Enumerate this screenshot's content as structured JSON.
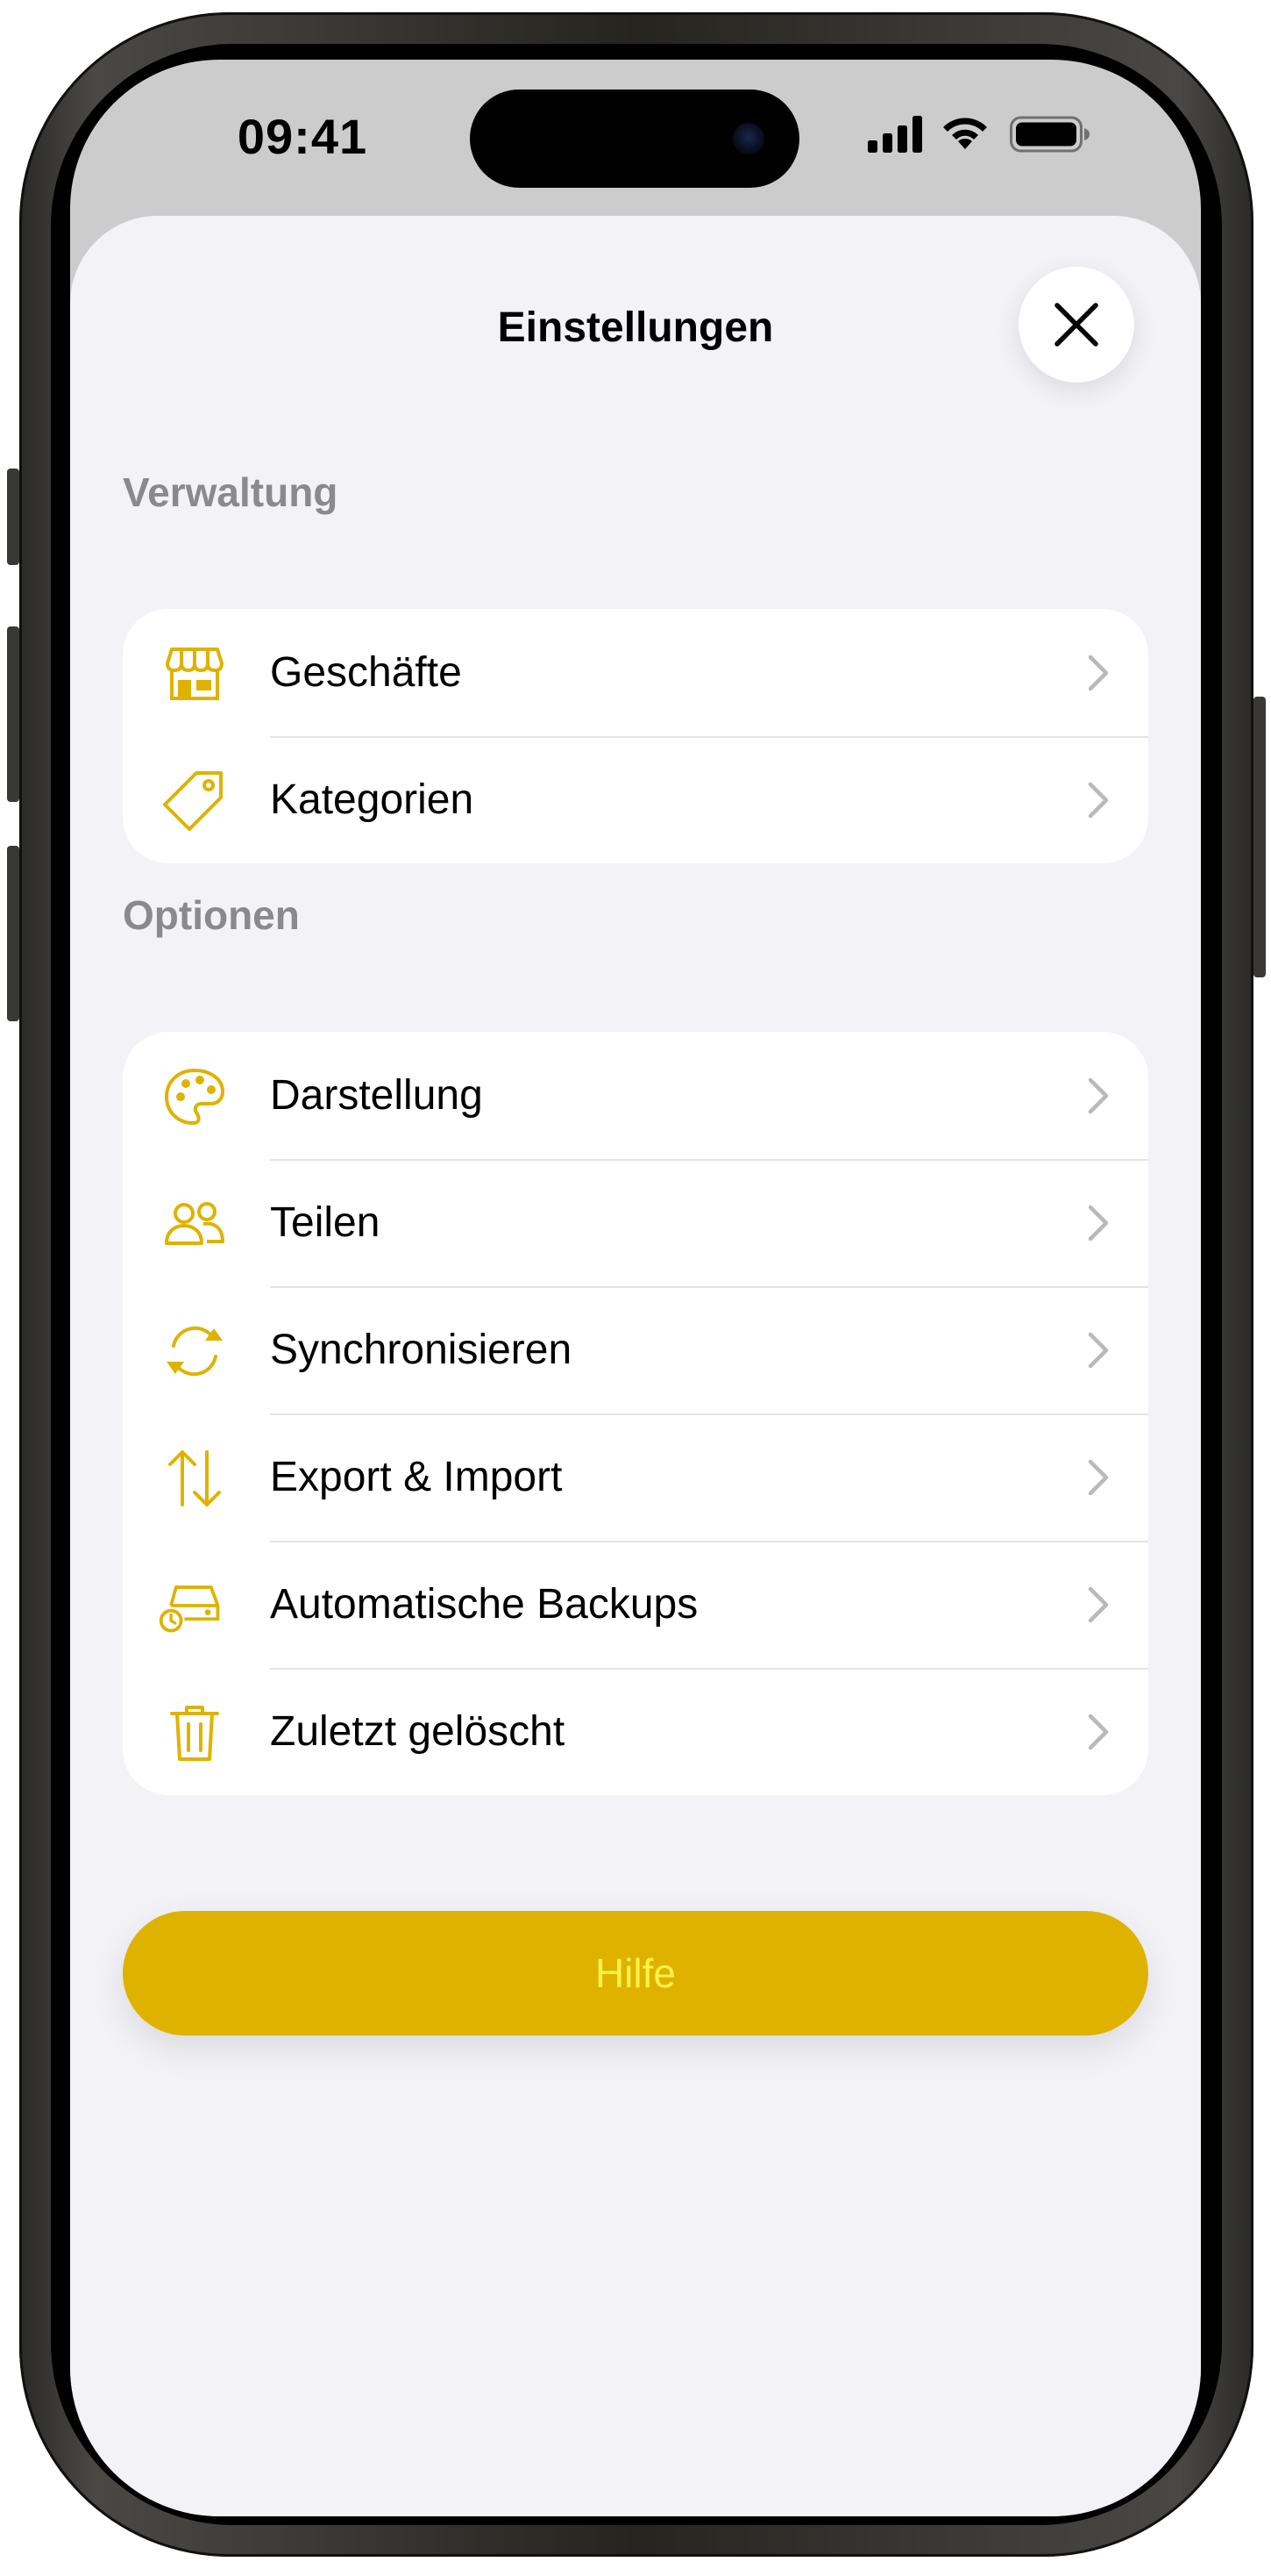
{
  "status_bar": {
    "time": "09:41"
  },
  "sheet": {
    "title": "Einstellungen",
    "close_icon": "close-icon"
  },
  "sections": [
    {
      "header": "Verwaltung",
      "items": [
        {
          "label": "Geschäfte",
          "icon": "store-icon"
        },
        {
          "label": "Kategorien",
          "icon": "tag-icon"
        }
      ]
    },
    {
      "header": "Optionen",
      "items": [
        {
          "label": "Darstellung",
          "icon": "palette-icon"
        },
        {
          "label": "Teilen",
          "icon": "people-icon"
        },
        {
          "label": "Synchronisieren",
          "icon": "sync-icon"
        },
        {
          "label": "Export & Import",
          "icon": "arrows-up-down-icon"
        },
        {
          "label": "Automatische Backups",
          "icon": "backup-drive-icon"
        },
        {
          "label": "Zuletzt gelöscht",
          "icon": "trash-icon"
        }
      ]
    }
  ],
  "help_button": {
    "label": "Hilfe"
  },
  "colors": {
    "accent": "#dfb200",
    "help_text": "#fff24a",
    "background": "#f2f2f7",
    "section_header": "#8a8a8e",
    "chevron": "#b9b9bd"
  }
}
